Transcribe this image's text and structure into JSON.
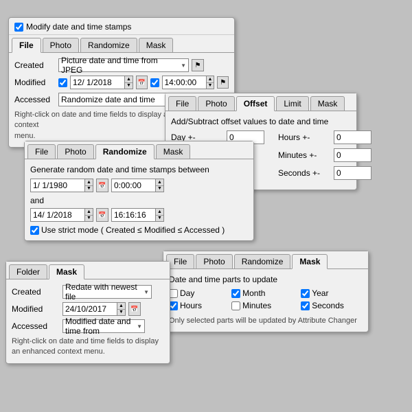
{
  "panel1": {
    "top_checkbox_label": "Modify date and time stamps",
    "tabs": [
      "File",
      "Photo",
      "Randomize",
      "Mask"
    ],
    "active_tab": "File",
    "rows": [
      {
        "label": "Created",
        "value": "Picture date and time from JPEG"
      },
      {
        "label": "Modified"
      },
      {
        "label": "Accessed",
        "value": "Randomize date and time"
      }
    ],
    "modified_date": "12/ 1/2018",
    "modified_time": "14:00:00",
    "note": "Right-click on date and time fields to display an enhanced context\nmenu."
  },
  "panel2": {
    "tabs": [
      "File",
      "Photo",
      "Randomize",
      "Mask"
    ],
    "active_tab": "Randomize",
    "title": "Generate random date and time stamps between",
    "date1": "1/ 1/1980",
    "time1": "0:00:00",
    "date2": "14/ 1/2018",
    "time2": "16:16:16",
    "strict_mode_label": "Use strict mode ( Created ≤ Modified ≤ Accessed )"
  },
  "panel3": {
    "tabs": [
      "File",
      "Photo",
      "Offset",
      "Limit",
      "Mask"
    ],
    "active_tab": "Offset",
    "title": "Add/Subtract offset values to date and time",
    "fields": [
      {
        "label": "Day +-",
        "value": "0"
      },
      {
        "label": "Hours +-",
        "value": "0"
      },
      {
        "label": "Minutes +-",
        "value": "0"
      },
      {
        "label": "Seconds +-",
        "value": "0"
      }
    ]
  },
  "panel4": {
    "tabs": [
      "File",
      "Photo",
      "Randomize",
      "Mask"
    ],
    "active_tab": "Mask",
    "title": "Date and time parts to update",
    "checkboxes": [
      {
        "label": "Day",
        "checked": false
      },
      {
        "label": "Month",
        "checked": true
      },
      {
        "label": "Year",
        "checked": true
      },
      {
        "label": "Hours",
        "checked": true
      },
      {
        "label": "Minutes",
        "checked": false
      },
      {
        "label": "Seconds",
        "checked": true
      }
    ],
    "note": "Only selected parts will be updated by Attribute Changer"
  },
  "panel5": {
    "tabs": [
      "Folder",
      "Mask"
    ],
    "active_tab": "Mask",
    "rows": [
      {
        "label": "Created",
        "value": "Redate with newest file"
      },
      {
        "label": "Modified",
        "date": "24/10/2017"
      },
      {
        "label": "Accessed",
        "value": "Modified date and time from"
      }
    ],
    "note": "Right-click on date and time fields to display an enhanced context\nmenu."
  }
}
